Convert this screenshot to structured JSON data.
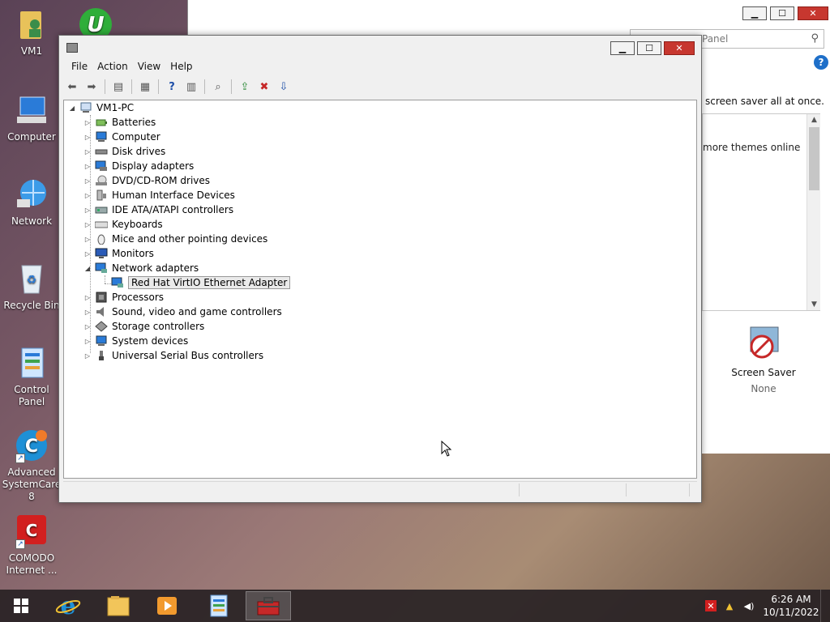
{
  "desktop": {
    "icons": [
      {
        "label": "VM1"
      },
      {
        "label": "Computer"
      },
      {
        "label": "Network"
      },
      {
        "label": "Recycle Bin"
      },
      {
        "label": "Control Panel"
      },
      {
        "label": "Advanced SystemCare 8"
      },
      {
        "label": "COMODO Internet ..."
      }
    ]
  },
  "control_panel": {
    "search_placeholder": "Panel",
    "help": "?",
    "text_screensaver": "screen saver all at once.",
    "link_more_themes": "more themes online",
    "screen_saver_label": "Screen Saver",
    "screen_saver_value": "None",
    "btn_min": "▁",
    "btn_max": "☐",
    "btn_close": "✕"
  },
  "device_manager": {
    "menu": [
      "File",
      "Action",
      "View",
      "Help"
    ],
    "btn_min": "▁",
    "btn_max": "☐",
    "btn_close": "✕",
    "root": "VM1-PC",
    "categories": [
      "Batteries",
      "Computer",
      "Disk drives",
      "Display adapters",
      "DVD/CD-ROM drives",
      "Human Interface Devices",
      "IDE ATA/ATAPI controllers",
      "Keyboards",
      "Mice and other pointing devices",
      "Monitors",
      "Network adapters",
      "Processors",
      "Sound, video and game controllers",
      "Storage controllers",
      "System devices",
      "Universal Serial Bus controllers"
    ],
    "expanded_child": "Red Hat VirtIO Ethernet Adapter"
  },
  "taskbar": {
    "time": "6:26 AM",
    "date": "10/11/2022"
  },
  "colors": {
    "close_red": "#c7372f",
    "ie_blue": "#1e90d6",
    "comodo_red": "#d21f1f",
    "iobit_green": "#2fae3a"
  }
}
